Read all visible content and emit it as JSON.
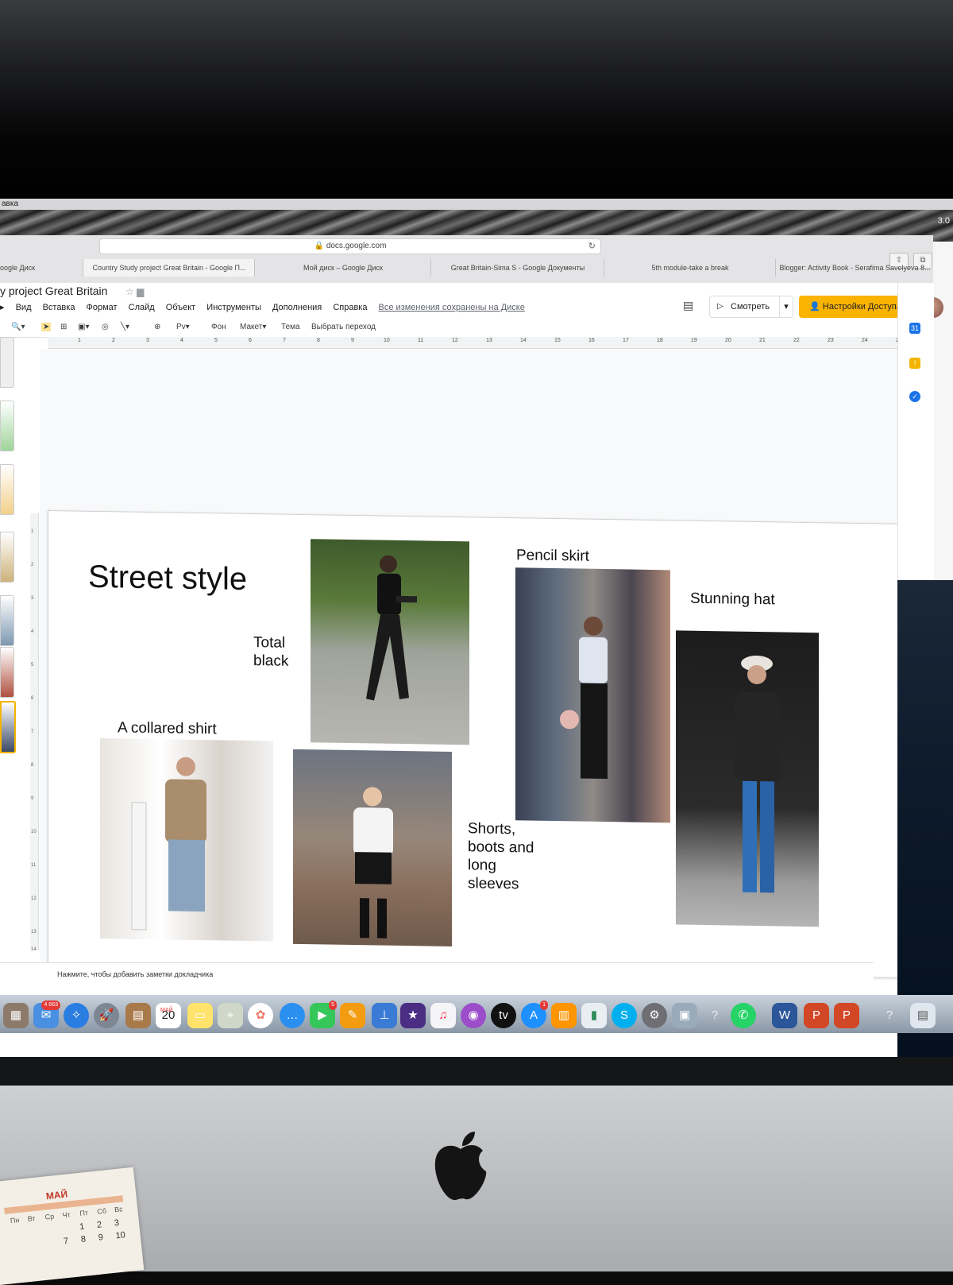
{
  "menubar": {
    "app_fragment": "авка"
  },
  "status": {
    "battery": "3.0"
  },
  "browser": {
    "url": "docs.google.com",
    "tabs": [
      {
        "label": "oogle Диск"
      },
      {
        "label": "Country Study project Great Britain - Google П..."
      },
      {
        "label": "Мой диск – Google Диск"
      },
      {
        "label": "Great Britain-Sima S - Google Документы"
      },
      {
        "label": "5th module-take a break"
      },
      {
        "label": "Blogger: Activity Book - Serafima Savelyeva 8..."
      }
    ]
  },
  "doc": {
    "title": "y project  Great Britain",
    "menus": [
      "Вид",
      "Вставка",
      "Формат",
      "Слайд",
      "Объект",
      "Инструменты",
      "Дополнения",
      "Справка"
    ],
    "saved_status": "Все изменения сохранены на Диске",
    "view_button": "Смотреть",
    "share_button": "Настройки Доступа"
  },
  "toolbar": {
    "background": "Фон",
    "layout": "Макет",
    "theme": "Тема",
    "transition": "Выбрать переход"
  },
  "ruler": [
    "1",
    "2",
    "3",
    "4",
    "5",
    "6",
    "7",
    "8",
    "9",
    "10",
    "11",
    "12",
    "13",
    "14",
    "15",
    "16",
    "17",
    "18",
    "19",
    "20",
    "21",
    "22",
    "23",
    "24",
    "25"
  ],
  "vruler": [
    "1",
    "2",
    "3",
    "4",
    "5",
    "6",
    "7",
    "8",
    "9",
    "10",
    "11",
    "12",
    "13",
    "14"
  ],
  "slide": {
    "title": "Street style",
    "labels": {
      "total_black": "Total black",
      "pencil_skirt": "Pencil skirt",
      "stunning_hat": "Stunning hat",
      "collared_shirt": "A collared shirt",
      "shorts": "Shorts, boots and long sleeves"
    }
  },
  "speaker_notes": "Нажмите, чтобы добавить заметки докладчика",
  "dock": {
    "badges": {
      "mail": "4 663",
      "calendar": "20",
      "calendar_month": "МАЙ",
      "messages": "5",
      "appstore": "1"
    },
    "icons": [
      "photos-icon",
      "mail-icon",
      "safari-icon",
      "launchpad-icon",
      "contacts-icon",
      "calendar-icon",
      "notes-icon",
      "maps-icon",
      "photos-app-icon",
      "messages-icon",
      "facetime-icon",
      "pages-icon",
      "keynote-icon",
      "imovie-icon",
      "music-icon",
      "podcasts-icon",
      "tv-icon",
      "appstore-icon",
      "books-icon",
      "numbers-icon",
      "skype-icon",
      "settings-icon",
      "preview-icon",
      "help-icon",
      "whatsapp-icon",
      "word-icon",
      "powerpoint-icon",
      "powerpoint-icon",
      "help-icon",
      "finder-icon"
    ]
  },
  "calendar": {
    "month": "МАЙ",
    "days": [
      "Пн",
      "Вт",
      "Ср",
      "Чт",
      "Пт",
      "Сб",
      "Вс"
    ],
    "row1": [
      "1",
      "2",
      "3"
    ],
    "row2": [
      "7",
      "8",
      "9",
      "10"
    ]
  },
  "colors": {
    "share": "#f9b300",
    "slide_bg": "#ffffff",
    "dock": "#a7b3c0"
  }
}
